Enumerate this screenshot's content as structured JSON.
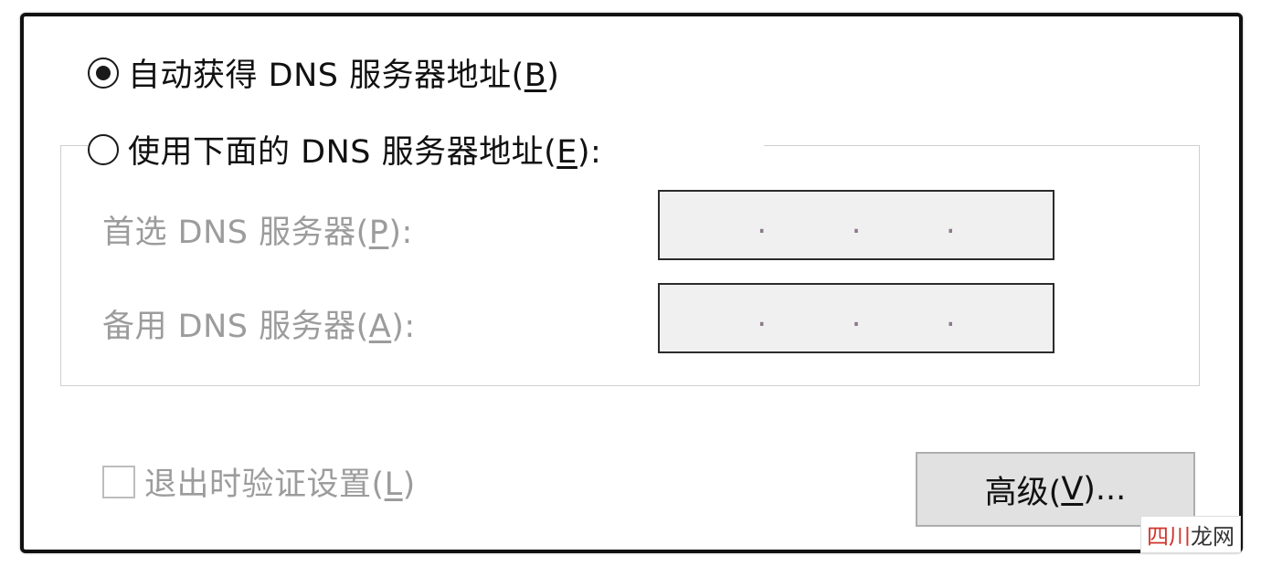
{
  "auto_dns": {
    "text": "自动获得 DNS 服务器地址(",
    "key": "B",
    "end": ")",
    "checked": true
  },
  "manual_dns": {
    "text": "使用下面的 DNS 服务器地址(",
    "key": "E",
    "end": "):",
    "checked": false
  },
  "preferred": {
    "text": "首选 DNS 服务器(",
    "key": "P",
    "end": "):",
    "dots": [
      ".",
      ".",
      "."
    ]
  },
  "alternate": {
    "text": "备用 DNS 服务器(",
    "key": "A",
    "end": "):",
    "dots": [
      ".",
      ".",
      "."
    ]
  },
  "validate": {
    "text": "退出时验证设置(",
    "key": "L",
    "end": ")",
    "checked": false
  },
  "advanced": {
    "text": "高级(",
    "key": "V",
    "end": ")..."
  },
  "watermark": {
    "part1": "四川",
    "part2": "龙网"
  }
}
